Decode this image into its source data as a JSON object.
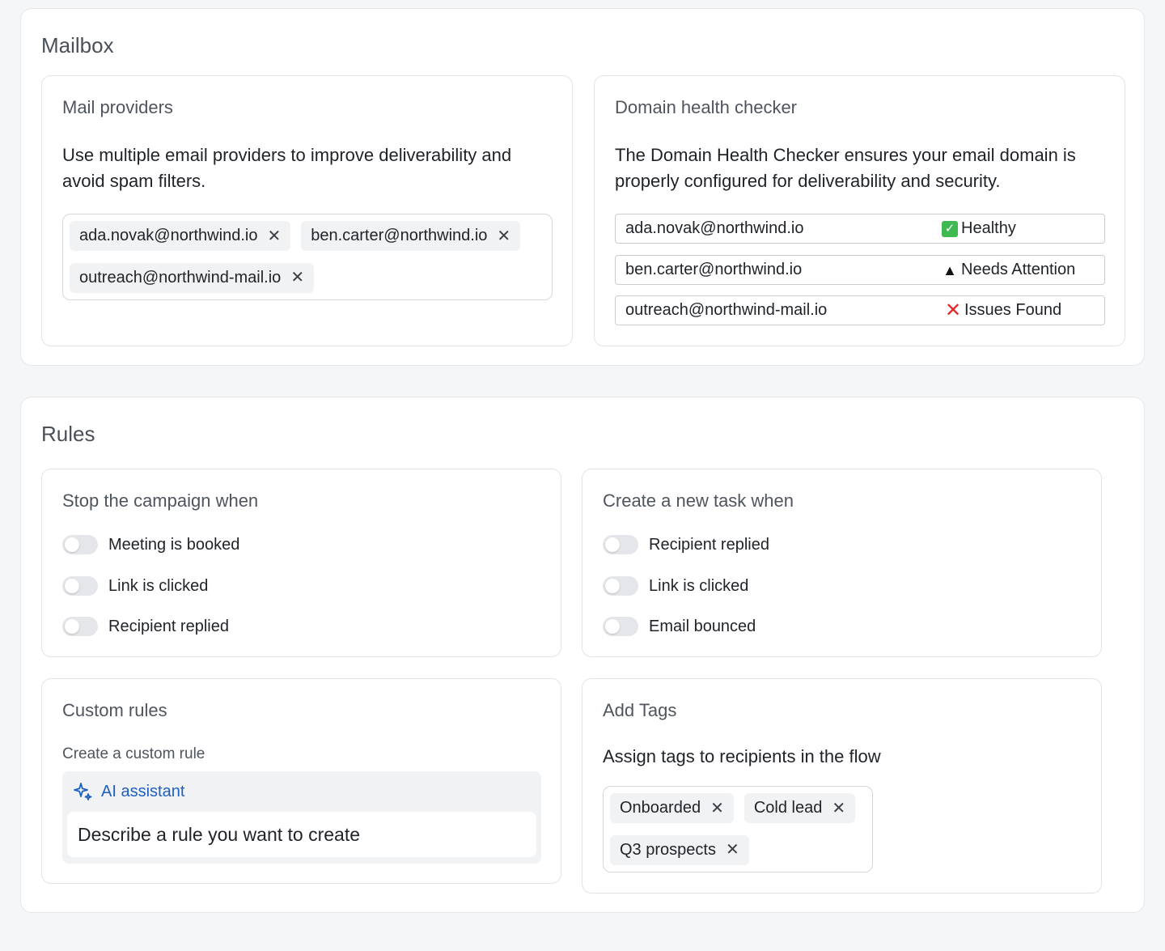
{
  "mailbox": {
    "title": "Mailbox",
    "providers": {
      "title": "Mail providers",
      "description": "Use multiple email providers to improve deliverability and avoid spam filters.",
      "chips": [
        {
          "label": "ada.novak@northwind.io",
          "remove_icon": "close-icon"
        },
        {
          "label": "ben.carter@northwind.io",
          "remove_icon": "close-icon"
        },
        {
          "label": "outreach@northwind-mail.io",
          "remove_icon": "close-icon"
        }
      ]
    },
    "health": {
      "title": "Domain health checker",
      "description": "The Domain Health Checker ensures your email domain is properly configured for deliverability and security.",
      "rows": [
        {
          "email": "ada.novak@northwind.io",
          "status": "Healthy",
          "icon": "check-icon",
          "icon_color": "#3fb950"
        },
        {
          "email": "ben.carter@northwind.io",
          "status": "Needs Attention",
          "icon": "warning-icon",
          "icon_color": "#111111"
        },
        {
          "email": "outreach@northwind-mail.io",
          "status": "Issues Found",
          "icon": "cross-icon",
          "icon_color": "#e5252a"
        }
      ]
    }
  },
  "rules": {
    "title": "Rules",
    "stop_campaign": {
      "title": "Stop the campaign when",
      "toggles": [
        {
          "label": "Meeting is booked",
          "on": false
        },
        {
          "label": "Link is clicked",
          "on": false
        },
        {
          "label": "Recipient replied",
          "on": false
        }
      ]
    },
    "new_task": {
      "title": "Create a new task when",
      "toggles": [
        {
          "label": "Recipient replied",
          "on": false
        },
        {
          "label": "Link is clicked",
          "on": false
        },
        {
          "label": "Email bounced",
          "on": false
        }
      ]
    },
    "custom": {
      "title": "Custom rules",
      "sub_label": "Create a custom rule",
      "ai_label": "AI assistant",
      "ai_icon": "sparkle-icon",
      "placeholder": "Describe a rule you want to create",
      "accent_color": "#1f5fc0"
    },
    "tags": {
      "title": "Add Tags",
      "description": "Assign tags to recipients in the flow",
      "chips": [
        {
          "label": "Onboarded",
          "remove_icon": "close-icon"
        },
        {
          "label": "Cold lead",
          "remove_icon": "close-icon"
        },
        {
          "label": "Q3 prospects",
          "remove_icon": "close-icon"
        }
      ]
    }
  }
}
